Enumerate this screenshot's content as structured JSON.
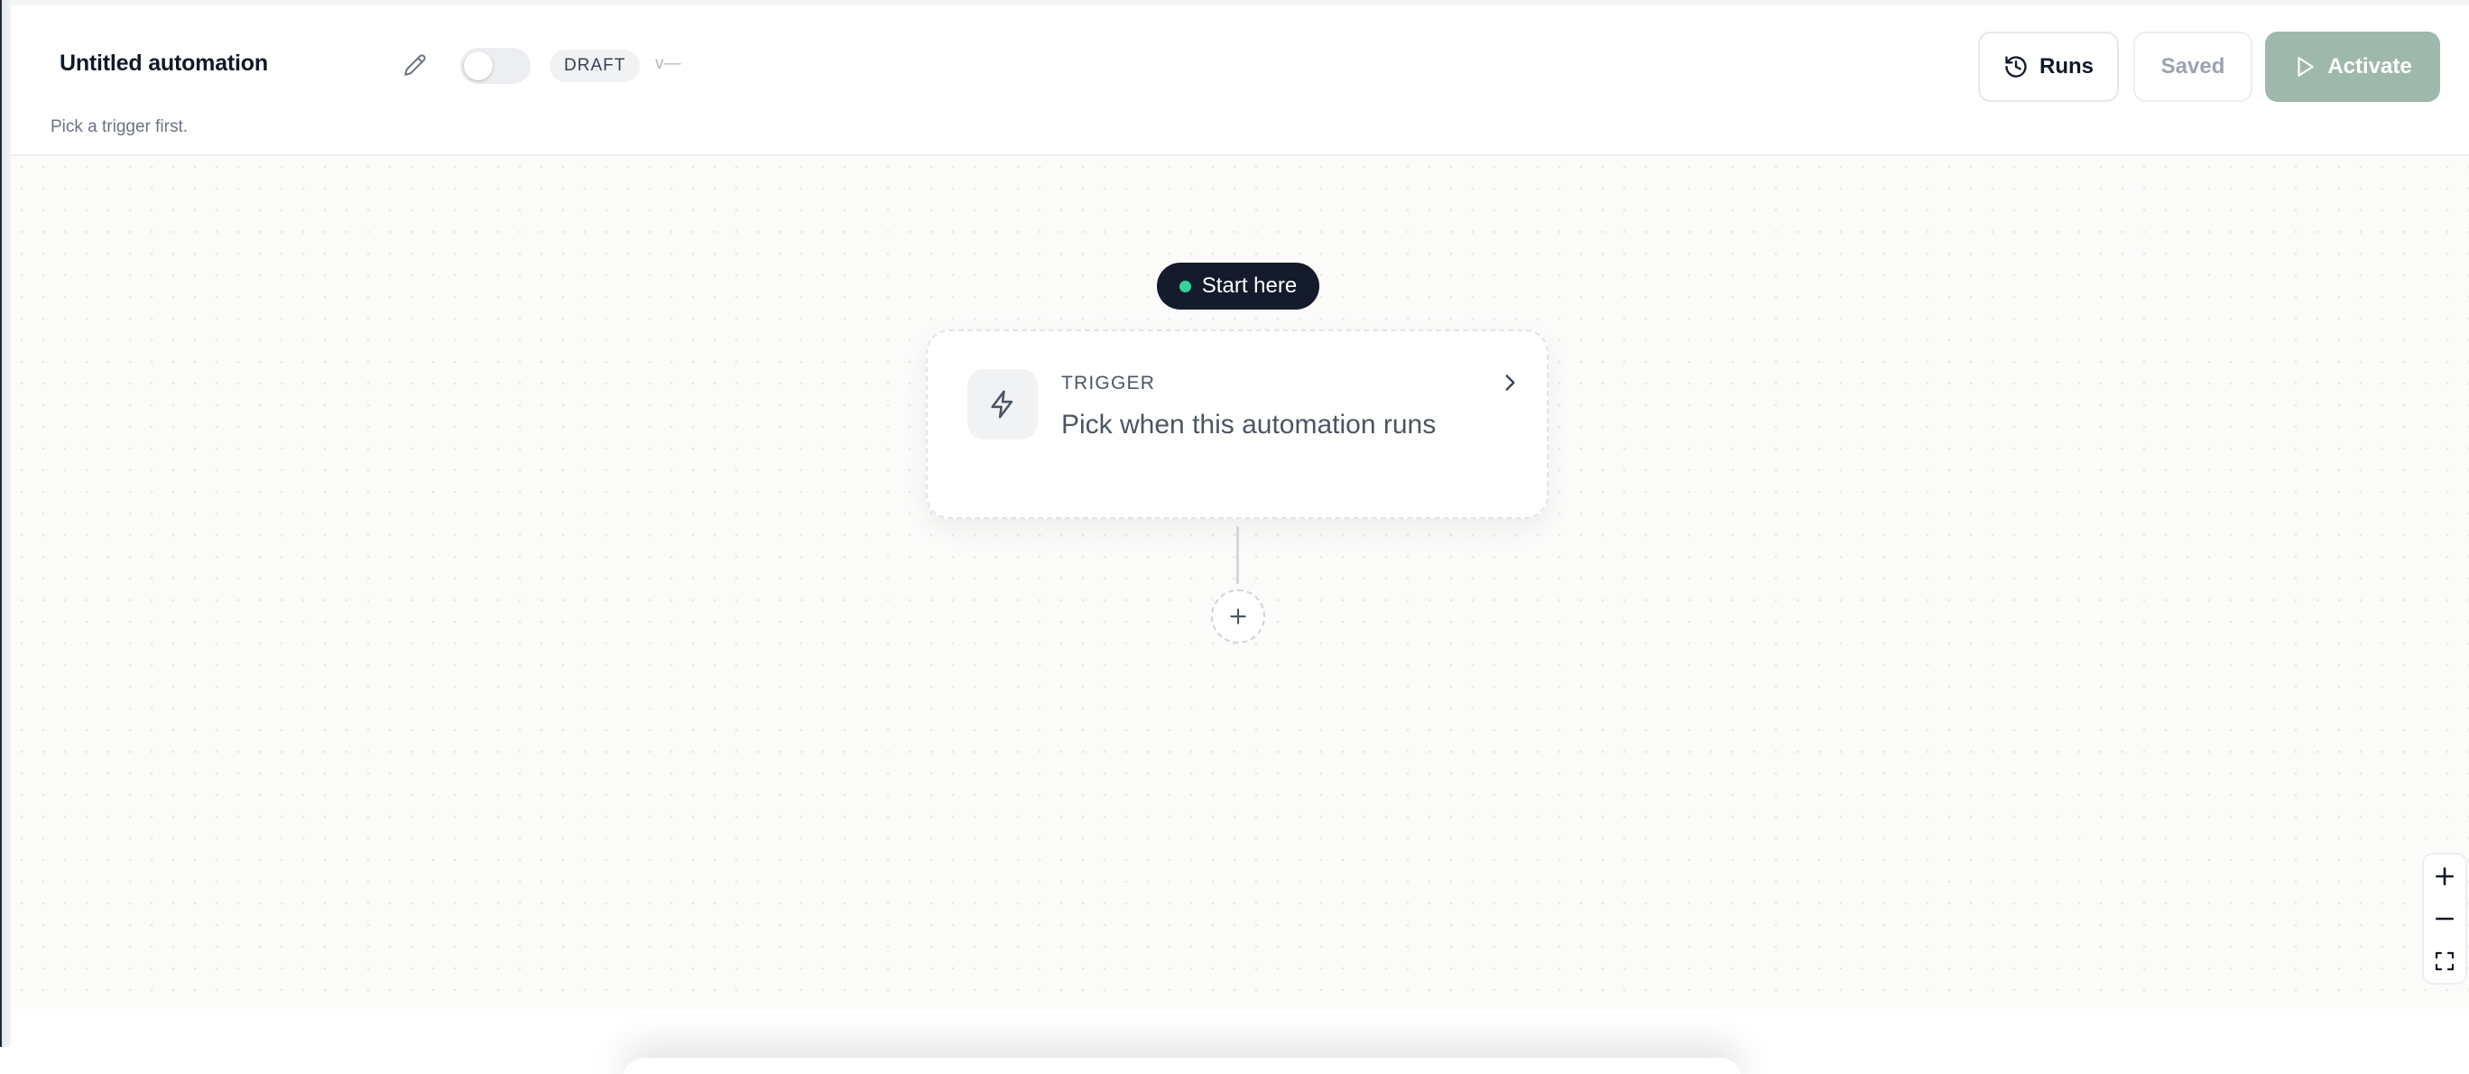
{
  "header": {
    "title": "Untitled automation",
    "status_badge": "DRAFT",
    "version": "v—",
    "subtitle": "Pick a trigger first.",
    "toggle_on": false,
    "buttons": {
      "runs": "Runs",
      "saved": "Saved",
      "activate": "Activate"
    }
  },
  "canvas": {
    "start_label": "Start here",
    "trigger": {
      "kicker": "TRIGGER",
      "text": "Pick when this automation runs"
    }
  },
  "colors": {
    "activate_bg": "#9fb8ac",
    "start_pill_bg": "#131b2c",
    "start_dot": "#34d399"
  }
}
